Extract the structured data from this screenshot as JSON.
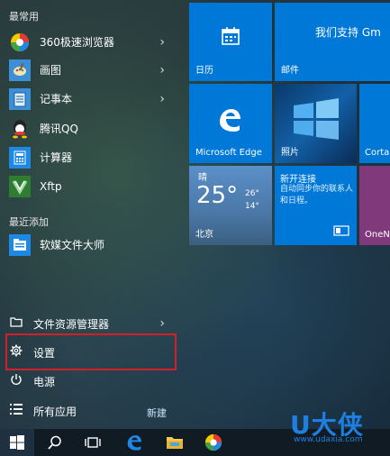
{
  "left_panel": {
    "most_used_header": "最常用",
    "apps": [
      {
        "label": "360极速浏览器",
        "icon": "360-browser-icon",
        "has_arrow": true
      },
      {
        "label": "画图",
        "icon": "paint-icon",
        "has_arrow": true
      },
      {
        "label": "记事本",
        "icon": "notepad-icon",
        "has_arrow": true
      },
      {
        "label": "腾讯QQ",
        "icon": "qq-icon",
        "has_arrow": false
      },
      {
        "label": "计算器",
        "icon": "calculator-icon",
        "has_arrow": false
      },
      {
        "label": "Xftp",
        "icon": "xftp-icon",
        "has_arrow": false
      }
    ],
    "recently_added_header": "最近添加",
    "recent_apps": [
      {
        "label": "软媒文件大师",
        "icon": "file-master-icon"
      }
    ],
    "system_items": [
      {
        "label": "文件资源管理器",
        "icon": "folder-icon",
        "has_arrow": true
      },
      {
        "label": "设置",
        "icon": "gear-icon",
        "has_arrow": false
      },
      {
        "label": "电源",
        "icon": "power-icon",
        "has_arrow": false
      },
      {
        "label": "所有应用",
        "icon": "list-icon",
        "has_arrow": false
      }
    ],
    "new_label": "新建"
  },
  "tiles": {
    "calendar": {
      "label": "日历",
      "color": "#0078d7",
      "icon": "calendar-icon"
    },
    "mail": {
      "label": "邮件",
      "header": "我们支持 Gm",
      "color": "#0078d7"
    },
    "edge": {
      "label": "Microsoft Edge",
      "color": "#0078d7",
      "icon": "edge-icon"
    },
    "photos": {
      "label": "照片",
      "icon": "photo-icon"
    },
    "cortana": {
      "label": "Corta",
      "color": "#0078d7"
    },
    "weather": {
      "condition": "晴",
      "temp": "25°",
      "high": "26°",
      "low": "14°",
      "city": "北京",
      "color": "#4a7db5"
    },
    "connect": {
      "title": "新开连接",
      "body": "自动同步你的联系人和日程。",
      "color": "#0078d7",
      "icon": "connect-icon"
    },
    "onenote": {
      "label": "OneN",
      "color": "#80397b"
    }
  },
  "taskbar": {
    "icons": [
      "windows-start-icon",
      "search-icon",
      "task-view-icon",
      "edge-icon",
      "file-explorer-icon",
      "360-browser-icon"
    ]
  },
  "watermark": {
    "brand": "U大侠",
    "url": "www.udaxia.com"
  }
}
